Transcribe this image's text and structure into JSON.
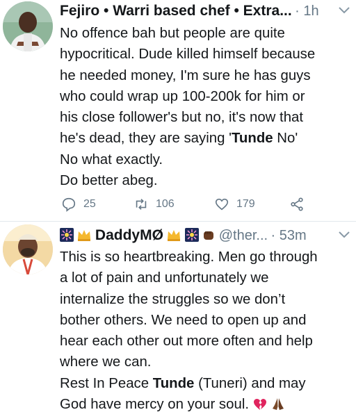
{
  "tweets": [
    {
      "name": "Fejiro • Warri based chef • Extra...",
      "time": "· 1h",
      "text_lines": [
        "No offence bah but people are quite",
        "hypocritical. Dude killed himself because",
        "he needed money, I'm sure he has guys",
        "who could wrap up 100-200k for him or",
        "his close follower's but no, it's now that"
      ],
      "line6_pre": "he's dead, they are saying '",
      "line6_bold": "Tunde",
      "line6_post": " No'",
      "line7": "No what exactly.",
      "line8": "Do better abeg.",
      "replies": "25",
      "retweets": "106",
      "likes": "179"
    },
    {
      "name": "DaddyMØ",
      "handle": "@ther...",
      "time": "· 53m",
      "text_lines": [
        "This is so heartbreaking. Men go through",
        "a lot of pain and unfortunately we",
        "internalize the struggles so we don’t",
        "bother others. We need to open up and",
        "hear each other out more often and help",
        "where we can."
      ],
      "line7_pre": "Rest In Peace ",
      "line7_bold": "Tunde",
      "line7_post": " (Tuneri) and may",
      "line8": "God have mercy on your soul."
    }
  ],
  "colors": {
    "text": "#14171a",
    "secondary": "#657786",
    "divider": "#e1e8ed"
  }
}
